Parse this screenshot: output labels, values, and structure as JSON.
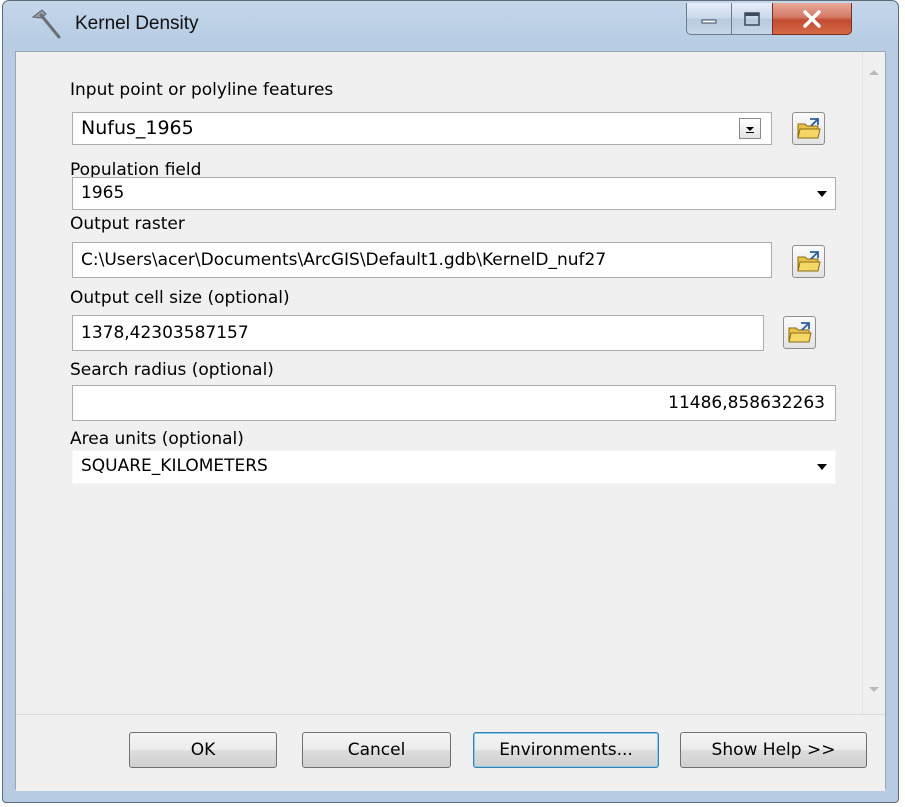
{
  "window": {
    "title": "Kernel Density",
    "icon": "hammer-icon",
    "controls": [
      "minimize-icon",
      "maximize-icon",
      "close-icon"
    ]
  },
  "form": {
    "input_features": {
      "label": "Input point or polyline features",
      "value": "Nufus_1965"
    },
    "population_field": {
      "label": "Population field",
      "value": "1965"
    },
    "output_raster": {
      "label": "Output raster",
      "value": "C:\\Users\\acer\\Documents\\ArcGIS\\Default1.gdb\\KernelD_nuf27"
    },
    "cell_size": {
      "label": "Output cell size (optional)",
      "value": "1378,42303587157"
    },
    "search_radius": {
      "label": "Search radius (optional)",
      "value": "11486,858632263"
    },
    "area_units": {
      "label": "Area units (optional)",
      "value": "SQUARE_KILOMETERS"
    }
  },
  "buttons": {
    "ok": "OK",
    "cancel": "Cancel",
    "environments": "Environments...",
    "show_help": "Show Help >>"
  },
  "colors": {
    "frame": "#b8cde4",
    "client": "#f0f0f0",
    "close_button": "#c44b31"
  }
}
